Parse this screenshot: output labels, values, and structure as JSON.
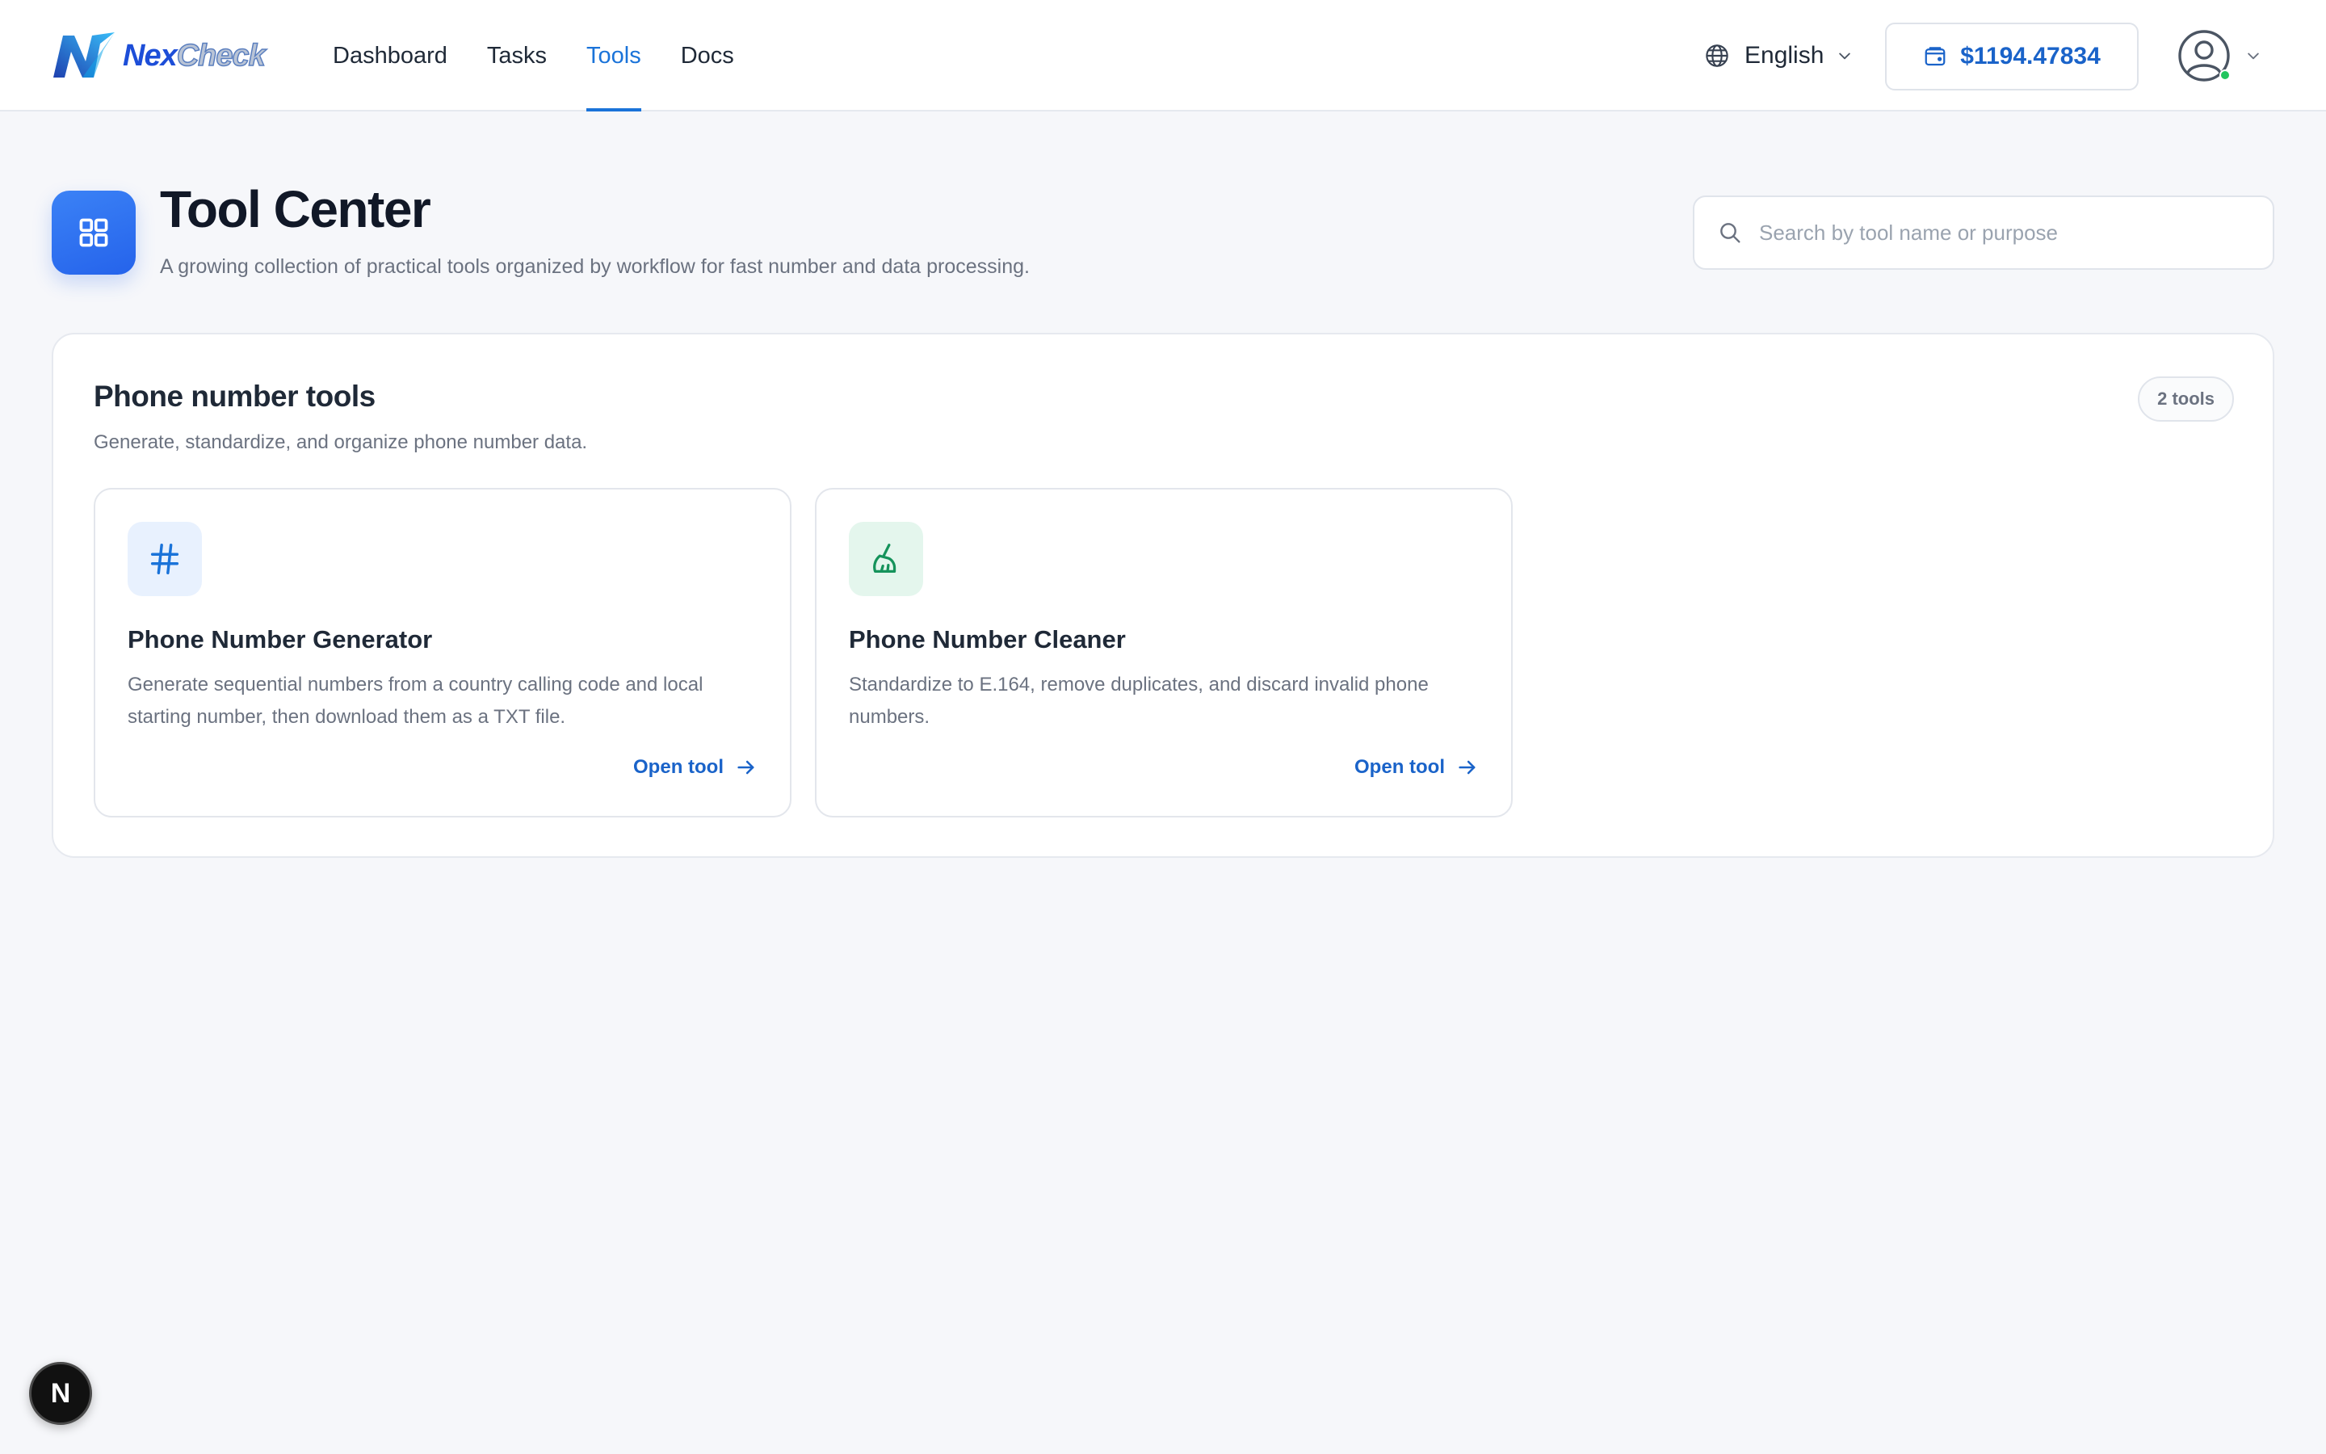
{
  "app": {
    "brand_prefix": "Nex",
    "brand_suffix": "Check"
  },
  "nav": {
    "items": [
      {
        "label": "Dashboard",
        "active": false
      },
      {
        "label": "Tasks",
        "active": false
      },
      {
        "label": "Tools",
        "active": true
      },
      {
        "label": "Docs",
        "active": false
      }
    ]
  },
  "header": {
    "language": "English",
    "balance": "$1194.47834",
    "icons": {
      "language": "globe-icon",
      "balance": "wallet-icon",
      "user": "user-circle-icon"
    },
    "status_color": "#22c55e"
  },
  "page": {
    "title": "Tool Center",
    "subtitle": "A growing collection of practical tools organized by workflow for fast number and data processing.",
    "icon": "grid-icon",
    "search": {
      "placeholder": "Search by tool name or purpose",
      "value": ""
    }
  },
  "section": {
    "title": "Phone number tools",
    "subtitle": "Generate, standardize, and organize phone number data.",
    "count_label": "2 tools",
    "tools": [
      {
        "name": "Phone Number Generator",
        "description": "Generate sequential numbers from a country calling code and local starting number, then download them as a TXT file.",
        "action": "Open tool",
        "icon": "hash-icon",
        "accent": "#1a73d9"
      },
      {
        "name": "Phone Number Cleaner",
        "description": "Standardize to E.164, remove duplicates, and discard invalid phone numbers.",
        "action": "Open tool",
        "icon": "broom-icon",
        "accent": "#15935b"
      }
    ]
  },
  "floating_badge": {
    "letter": "N"
  },
  "colors": {
    "accent": "#1a73d9",
    "background": "#f6f7fa"
  }
}
